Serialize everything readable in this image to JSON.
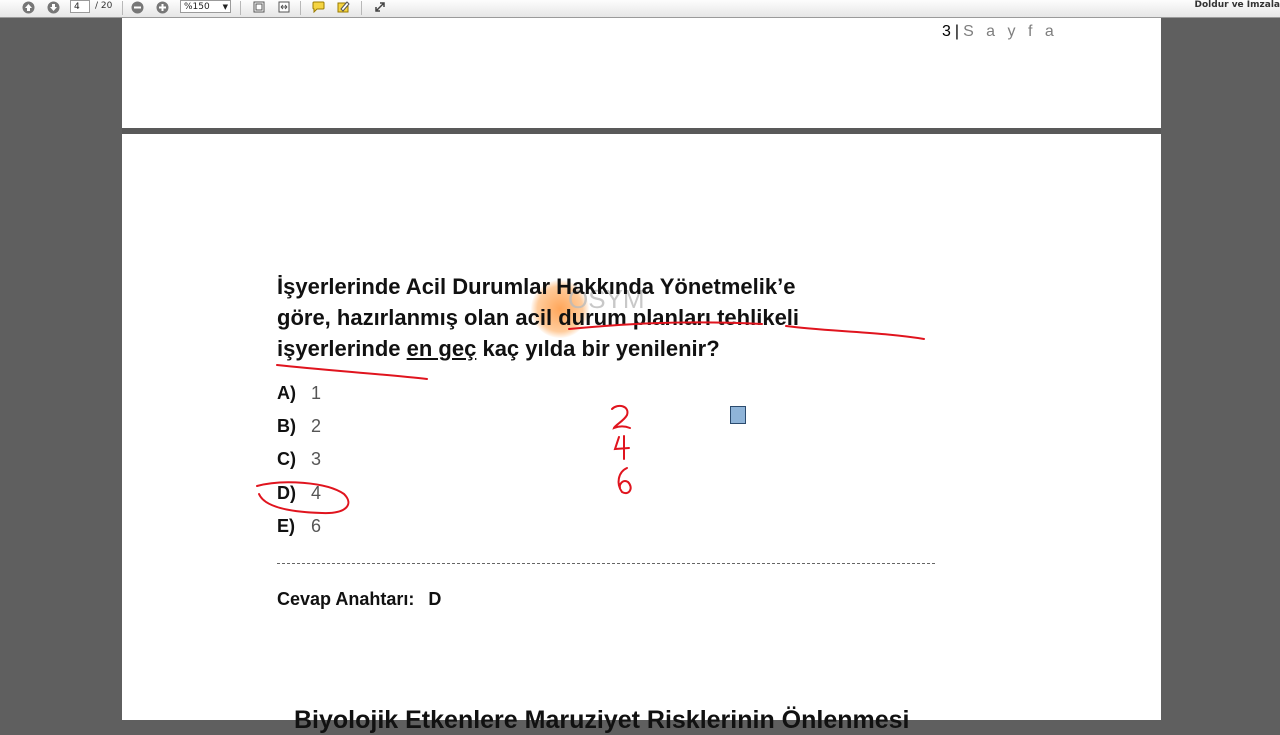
{
  "toolbar": {
    "page_current": "4",
    "page_total": "/ 20",
    "zoom": "%150",
    "fill_sign": "Doldur ve İmzala"
  },
  "prev_page": {
    "page_number": "3",
    "separator": "|",
    "page_word": "S a y f a"
  },
  "question": {
    "line1": "İşyerlerinde Acil Durumlar Hakkında Yönetmelik’e",
    "line2_a": "göre, hazırlanmış olan acil durum planları tehlikeli",
    "line3_a": "işyerlerinde ",
    "line3_underlined": "en geç",
    "line3_b": " kaç yılda bir yenilenir?",
    "watermark": "ÖSYM"
  },
  "options": [
    {
      "label": "A)",
      "value": "1"
    },
    {
      "label": "B)",
      "value": "2"
    },
    {
      "label": "C)",
      "value": "3"
    },
    {
      "label": "D)",
      "value": "4"
    },
    {
      "label": "E)",
      "value": "6"
    }
  ],
  "answer_key": {
    "label": "Cevap Anahtarı:",
    "value": "D"
  },
  "next_section_title": "Biyolojik Etkenlere Maruziyet Risklerinin Önlenmesi",
  "annotation_color": "#e0141e",
  "handwritten_digits": [
    "2",
    "4",
    "6"
  ]
}
